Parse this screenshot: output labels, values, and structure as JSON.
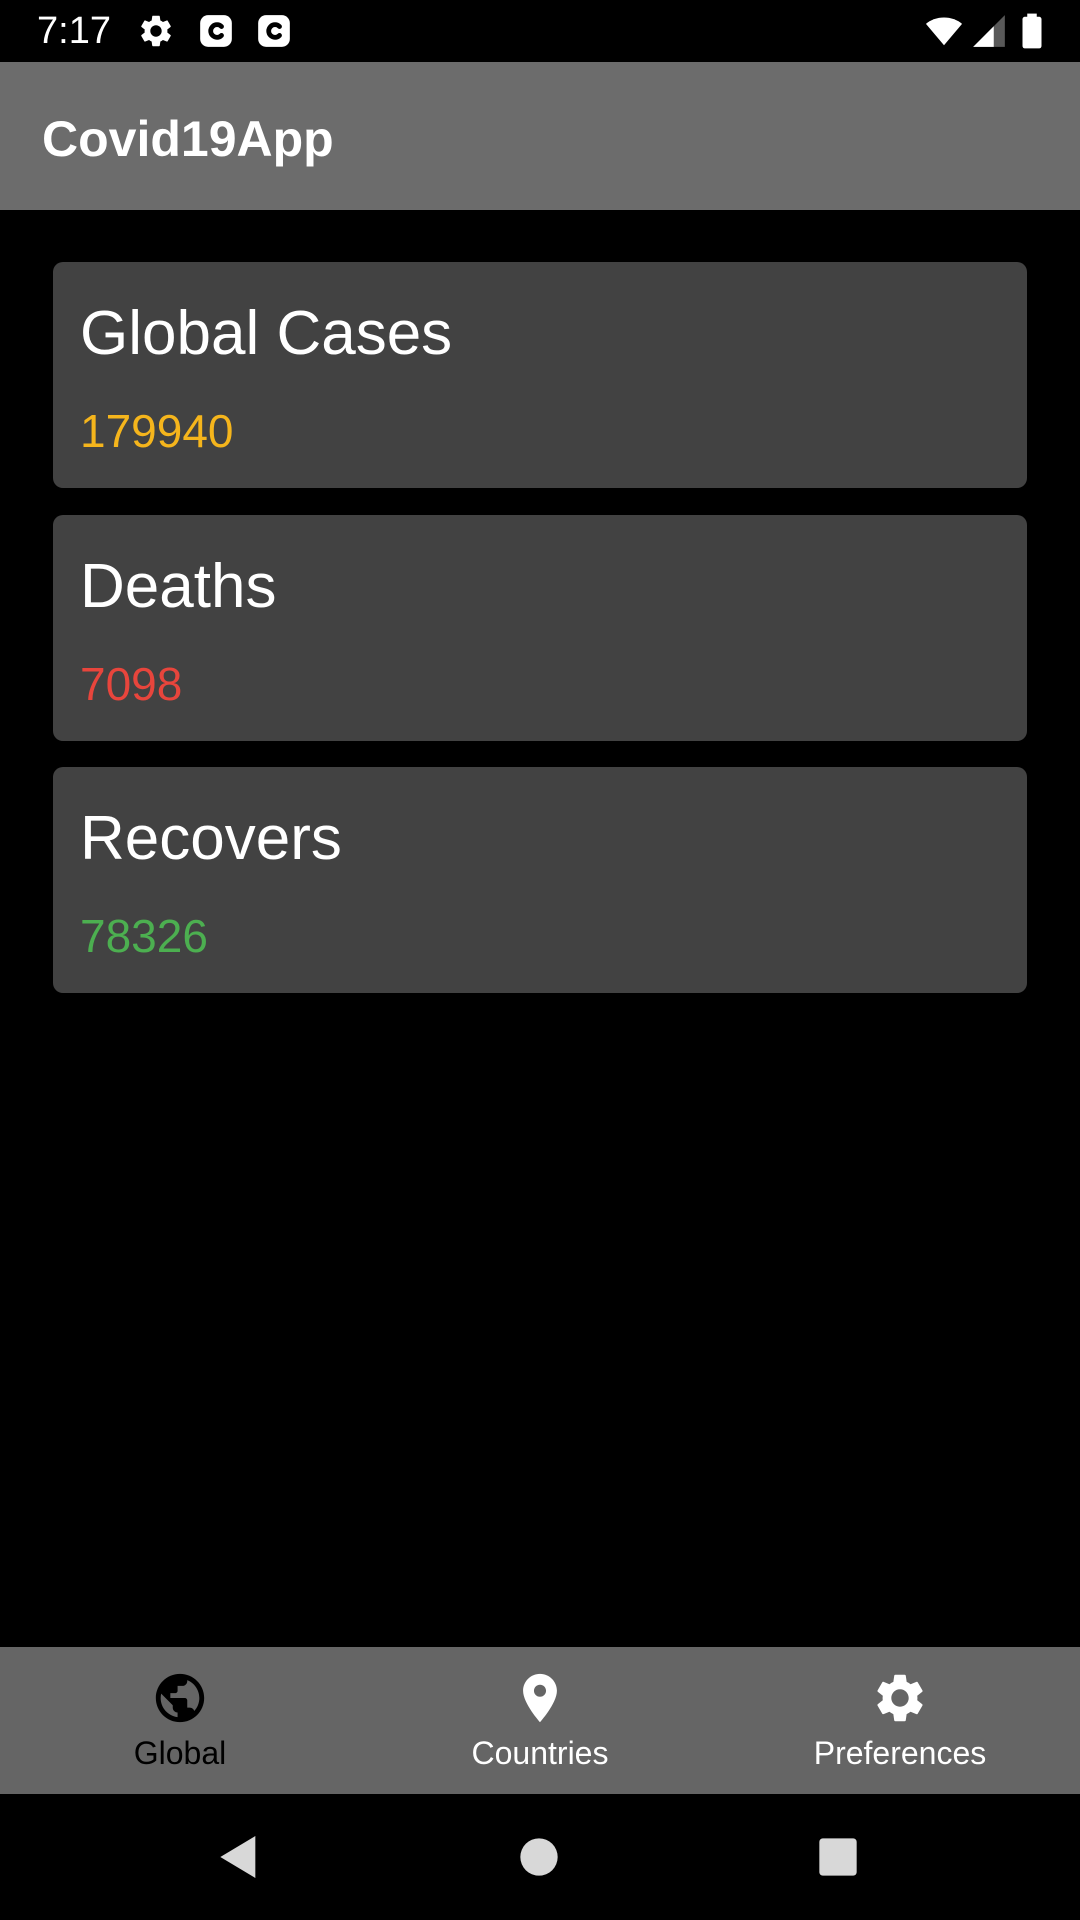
{
  "status_bar": {
    "time": "7:17",
    "icons": [
      "gear-icon",
      "c-notification-icon",
      "c-notification-icon",
      "wifi-icon",
      "cell-signal-icon",
      "battery-icon"
    ]
  },
  "app_bar": {
    "title": "Covid19App"
  },
  "cards": [
    {
      "title": "Global Cases",
      "value": "179940",
      "value_color": "#f5b51c"
    },
    {
      "title": "Deaths",
      "value": "7098",
      "value_color": "#e8453c"
    },
    {
      "title": "Recovers",
      "value": "78326",
      "value_color": "#4caf50"
    }
  ],
  "bottom_nav": {
    "items": [
      {
        "label": "Global",
        "icon": "globe-icon",
        "selected": true
      },
      {
        "label": "Countries",
        "icon": "location-pin-icon",
        "selected": false
      },
      {
        "label": "Preferences",
        "icon": "gear-icon",
        "selected": false
      }
    ],
    "selected_color": "#000000",
    "unselected_color": "#ffffff"
  },
  "system_nav": {
    "buttons": [
      "back-icon",
      "home-icon",
      "recents-icon"
    ]
  }
}
